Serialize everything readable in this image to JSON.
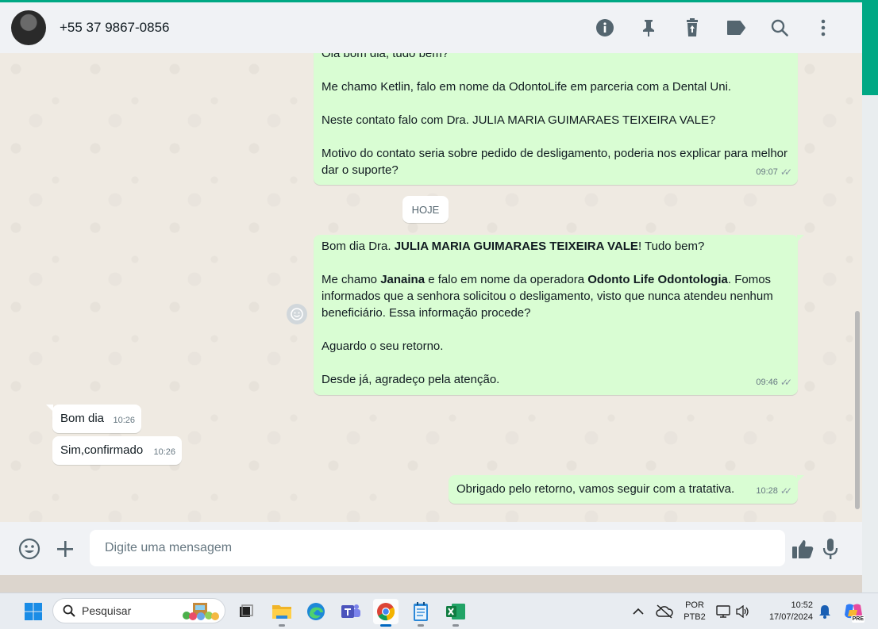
{
  "header": {
    "contact_name": "+55 37 9867-0856",
    "icons": [
      "info-icon",
      "pin-icon",
      "delete-icon",
      "label-icon",
      "search-icon",
      "menu-icon"
    ]
  },
  "chat": {
    "messages": [
      {
        "direction": "outgoing",
        "paragraphs": [
          "Olá bom dia, tudo bem?",
          "Me chamo Ketlin, falo em nome da OdontoLife em parceria com a Dental Uni.",
          "Neste contato falo com Dra. JULIA MARIA GUIMARAES TEIXEIRA VALE?",
          "Motivo do contato seria sobre pedido de desligamento, poderia nos explicar para melhor dar o suporte?"
        ],
        "time": "09:07",
        "status": "read"
      },
      {
        "direction": "outgoing",
        "p1_a": "Bom dia Dra. ",
        "p1_b": "JULIA MARIA GUIMARAES TEIXEIRA VALE",
        "p1_c": "! Tudo bem?",
        "p2_a": "Me chamo ",
        "p2_b": "Janaina",
        "p2_c": " e falo em nome da operadora ",
        "p2_d": "Odonto Life Odontologia",
        "p2_e": ". Fomos informados que a senhora solicitou o desligamento, visto que nunca atendeu nenhum beneficiário. Essa informação procede?",
        "p3": "Aguardo o seu retorno.",
        "p4": "Desde já, agradeço pela atenção.",
        "time": "09:46",
        "status": "read"
      },
      {
        "direction": "incoming",
        "text": "Bom dia",
        "time": "10:26"
      },
      {
        "direction": "incoming",
        "text": "Sim,confirmado",
        "time": "10:26"
      },
      {
        "direction": "outgoing",
        "text": "Obrigado pelo retorno, vamos seguir com a tratativa.",
        "time": "10:28",
        "status": "read"
      }
    ],
    "date_divider": "HOJE",
    "ticks": "✓✓"
  },
  "composer": {
    "placeholder": "Digite uma mensagem",
    "value": ""
  },
  "taskbar": {
    "search_label": "Pesquisar",
    "language_line1": "POR",
    "language_line2": "PTB2",
    "time": "10:52",
    "date": "17/07/2024",
    "copilot_badge": "PRE"
  },
  "colors": {
    "accent": "#00a884",
    "outgoing_bubble": "#d9fdd3",
    "incoming_bubble": "#ffffff",
    "chat_background": "#efeae2",
    "header_background": "#f0f2f5"
  }
}
